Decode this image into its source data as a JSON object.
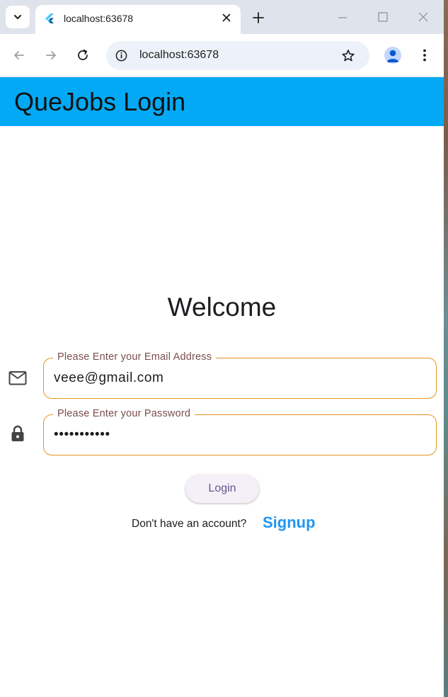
{
  "browser": {
    "tab_title": "localhost:63678",
    "url": "localhost:63678"
  },
  "appbar": {
    "title": "QueJobs Login",
    "color": "#03a9f4"
  },
  "main": {
    "welcome": "Welcome",
    "email": {
      "label": "Please Enter your Email Address",
      "value": "veee@gmail.com",
      "icon": "mail-icon"
    },
    "password": {
      "label": "Please Enter your Password",
      "value": "•••••••••••",
      "icon": "lock-icon"
    },
    "login_label": "Login",
    "signup_prompt": "Don't have an account?",
    "signup_label": "Signup",
    "accent_color": "#e5951f",
    "link_color": "#2196f3"
  }
}
